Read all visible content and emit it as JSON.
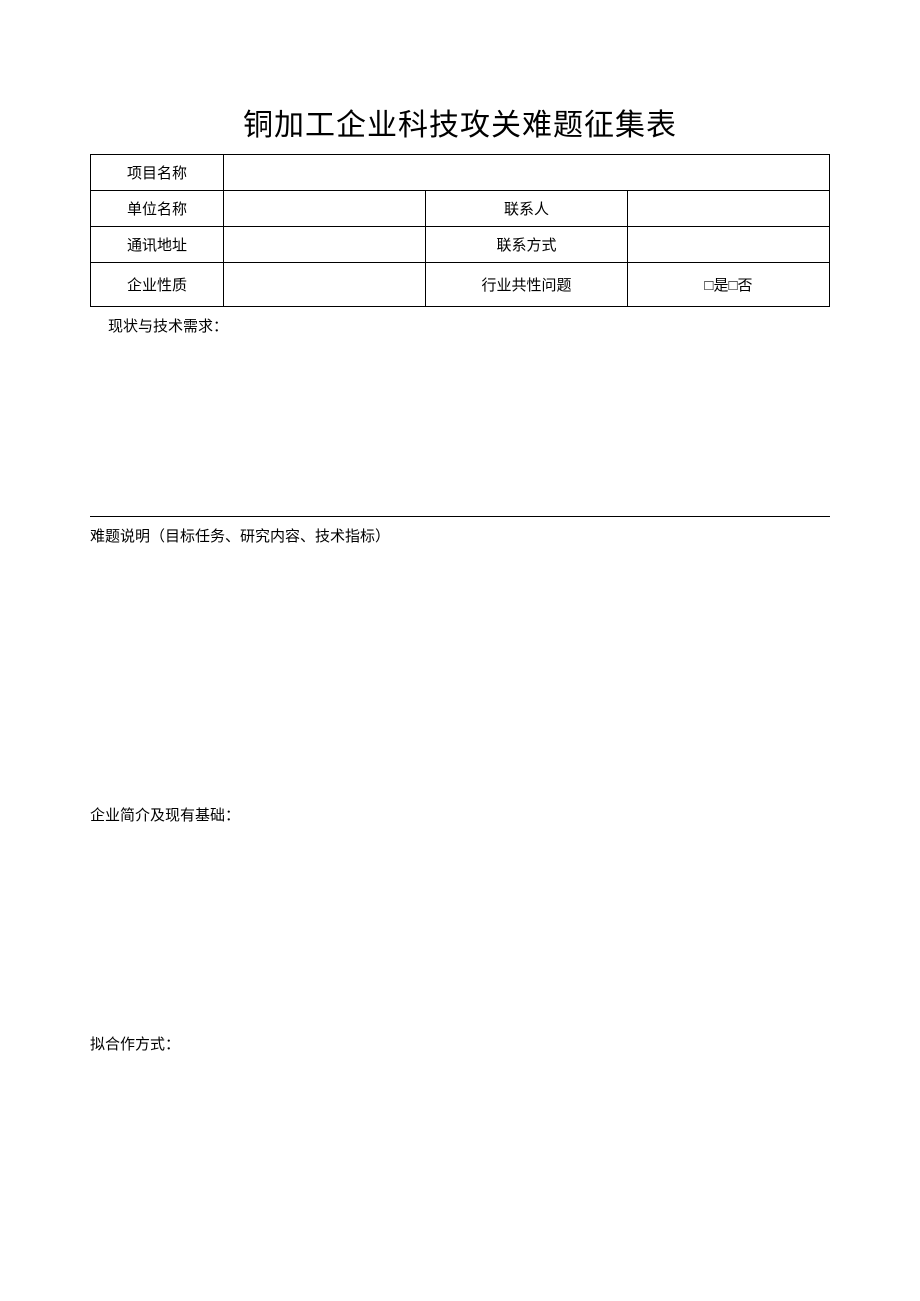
{
  "title": "铜加工企业科技攻关难题征集表",
  "table": {
    "row1": {
      "label": "项目名称"
    },
    "row2": {
      "label": "单位名称",
      "label2": "联系人"
    },
    "row3": {
      "label": "通讯地址",
      "label2": "联系方式"
    },
    "row4": {
      "label": "企业性质",
      "label2": "行业共性问题",
      "value2": "□是□否"
    }
  },
  "sections": {
    "s1": "现状与技术需求：",
    "s2": "难题说明（目标任务、研究内容、技术指标）",
    "s3": "企业简介及现有基础：",
    "s4": "拟合作方式："
  }
}
